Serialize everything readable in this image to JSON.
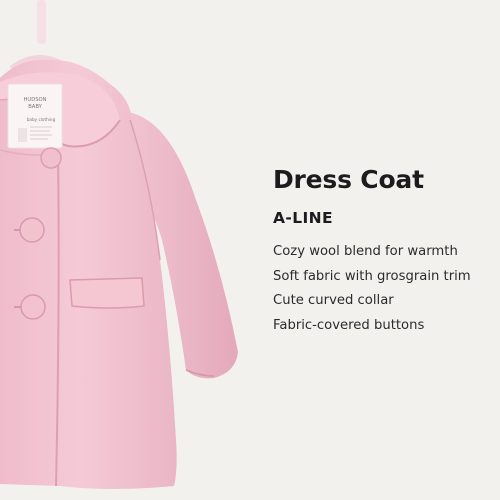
{
  "product": {
    "title": "Dress Coat",
    "subtitle": "A-LINE",
    "features": [
      "Cozy wool blend for warmth",
      "Soft fabric with grosgrain trim",
      "Cute curved collar",
      "Fabric-covered buttons"
    ]
  },
  "label": {
    "brand_line1": "HUDSON",
    "brand_line2": "BABY",
    "subline": "baby clothing"
  },
  "colors": {
    "background": "#f3f1ee",
    "coat_pink": "#f3c5d2",
    "coat_shadow": "#e3adbd",
    "hanger": "#f6dde4",
    "text": "#1c1c1f"
  },
  "icons": {
    "garment": "coat-illustration",
    "hanger": "hanger-icon"
  }
}
